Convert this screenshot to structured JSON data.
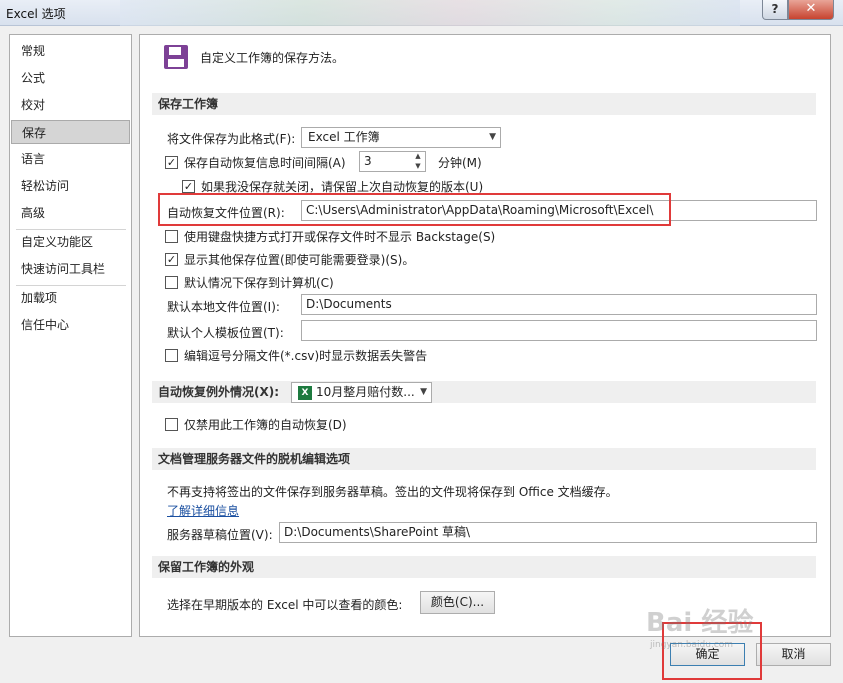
{
  "window": {
    "title": "Excel 选项",
    "help_label": "?",
    "close_label": "✕"
  },
  "nav": {
    "items": [
      "常规",
      "公式",
      "校对",
      "保存",
      "语言",
      "轻松访问",
      "高级",
      "自定义功能区",
      "快速访问工具栏",
      "加载项",
      "信任中心"
    ],
    "selected": "保存"
  },
  "header": {
    "text": "自定义工作簿的保存方法。",
    "icon": "save-icon"
  },
  "save_section": {
    "title": "保存工作簿",
    "format_label": "将文件保存为此格式(F):",
    "format_value": "Excel 工作簿",
    "autorecover_label": "保存自动恢复信息时间间隔(A)",
    "autorecover_checked": true,
    "autorecover_minutes": "3",
    "minutes_label": "分钟(M)",
    "keep_last_label": "如果我没保存就关闭，请保留上次自动恢复的版本(U)",
    "keep_last_checked": true,
    "autorecover_location_label": "自动恢复文件位置(R):",
    "autorecover_location_value": "C:\\Users\\Administrator\\AppData\\Roaming\\Microsoft\\Excel\\",
    "no_backstage_label": "使用键盘快捷方式打开或保存文件时不显示 Backstage(S)",
    "no_backstage_checked": false,
    "show_other_label": "显示其他保存位置(即使可能需要登录)(S)。",
    "show_other_checked": true,
    "save_to_computer_label": "默认情况下保存到计算机(C)",
    "save_to_computer_checked": false,
    "local_location_label": "默认本地文件位置(I):",
    "local_location_value": "D:\\Documents",
    "template_location_label": "默认个人模板位置(T):",
    "template_location_value": "",
    "csv_warning_label": "编辑逗号分隔文件(*.csv)时显示数据丢失警告",
    "csv_warning_checked": false
  },
  "exceptions_section": {
    "title": "自动恢复例外情况(X):",
    "workbook_value": "10月整月赔付数...",
    "disable_label": "仅禁用此工作簿的自动恢复(D)",
    "disable_checked": false
  },
  "offline_section": {
    "title": "文档管理服务器文件的脱机编辑选项",
    "info_text": "不再支持将签出的文件保存到服务器草稿。签出的文件现将保存到 Office 文档缓存。",
    "learn_more": "了解详细信息",
    "drafts_label": "服务器草稿位置(V):",
    "drafts_value": "D:\\Documents\\SharePoint 草稿\\"
  },
  "appearance_section": {
    "title": "保留工作簿的外观",
    "colors_label": "选择在早期版本的 Excel 中可以查看的颜色:",
    "colors_button": "颜色(C)..."
  },
  "footer": {
    "ok_label": "确定",
    "cancel_label": "取消"
  },
  "watermark": {
    "text": "Bai 经验",
    "sub": "jingyan.baidu.com"
  }
}
